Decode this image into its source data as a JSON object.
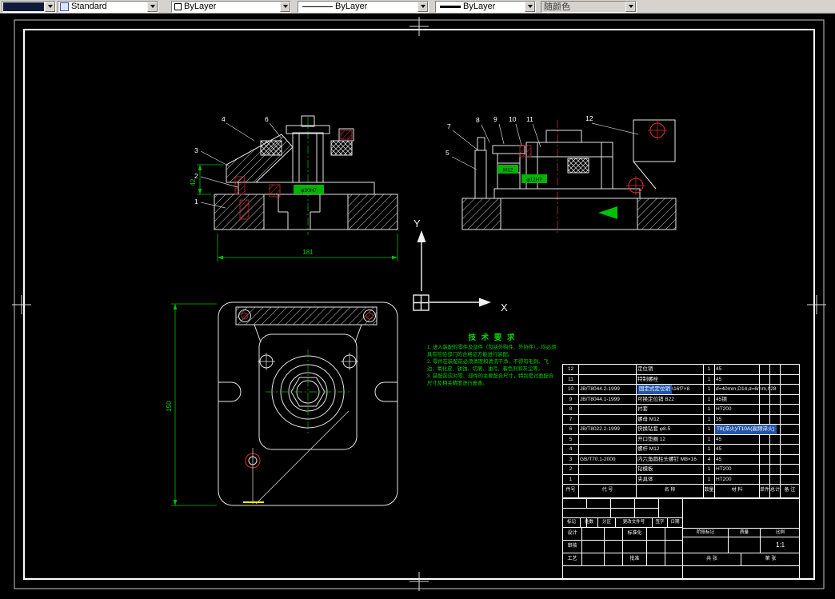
{
  "toolbar": {
    "style_combo": "Standard",
    "color_combo": "ByLayer",
    "linetype_combo": "ByLayer",
    "lineweight_combo": "ByLayer",
    "plotstyle_combo": "随颜色"
  },
  "ucs": {
    "x": "X",
    "y": "Y"
  },
  "balloons": {
    "front": [
      "4",
      "6",
      "3",
      "2",
      "1"
    ],
    "side": [
      "7",
      "8",
      "9",
      "10",
      "11",
      "12",
      "5"
    ]
  },
  "dimensions": {
    "front_width": "181",
    "front_height": "42",
    "front_bore": "φ30H7",
    "side_thread": "M12",
    "side_bore": "φ12H7",
    "plan_height": "150"
  },
  "tech_requirements": {
    "title": "技 术 要 求",
    "items": [
      "1. 进入装配的零件及部件（包括外购件、外协件），均必须具有检验部门的合格证方能进行装配。",
      "2. 零件在装配前必须清理和清洗干净，不得有毛刺、飞边、氧化皮、锈蚀、切屑、油污、着色剂和灰尘等。",
      "3. 装配前应对零、部件的主要配合尺寸，特别是过盈配合尺寸及相关精度进行复查。"
    ]
  },
  "bom": {
    "header": [
      "件号",
      "代 号",
      "名 称",
      "数量",
      "材 料",
      "单件",
      "总计",
      "备 注"
    ],
    "rows": [
      {
        "cells": [
          "12",
          "",
          "定位销",
          "1",
          "45",
          "",
          "",
          ""
        ]
      },
      {
        "cells": [
          "11",
          "",
          "特制螺栓",
          "1",
          "45",
          "",
          "",
          ""
        ]
      },
      {
        "cells": [
          "10",
          "JB/T8044.2-1999",
          "固定式定位销 A16f7×8",
          "1",
          "d=40mm,D14,d=6mm,h28",
          "",
          "",
          ""
        ]
      },
      {
        "cells": [
          "9",
          "JB/T8044.1-1999",
          "可换定位销 B22",
          "1",
          "45钢",
          "",
          "",
          ""
        ]
      },
      {
        "cells": [
          "8",
          "",
          "衬套",
          "1",
          "HT200",
          "",
          "",
          ""
        ]
      },
      {
        "cells": [
          "7",
          "",
          "螺母 M12",
          "1",
          "35",
          "",
          "",
          ""
        ]
      },
      {
        "cells": [
          "6",
          "JB/T8022.2-1999",
          "快换钻套 φ8.5",
          "1",
          "T8(淬火)/T10A(高频淬火)",
          "",
          "",
          ""
        ]
      },
      {
        "cells": [
          "5",
          "",
          "开口垫圈 12",
          "1",
          "45",
          "",
          "",
          ""
        ]
      },
      {
        "cells": [
          "4",
          "",
          "螺杆 M12",
          "1",
          "45",
          "",
          "",
          ""
        ]
      },
      {
        "cells": [
          "3",
          "GB/T70.1-2000",
          "内六角圆柱头螺钉 M8×16",
          "4",
          "45",
          "",
          "",
          ""
        ]
      },
      {
        "cells": [
          "2",
          "",
          "钻模板",
          "1",
          "HT200",
          "",
          "",
          ""
        ]
      },
      {
        "cells": [
          "1",
          "",
          "夹具体",
          "1",
          "HT200",
          "",
          "",
          ""
        ]
      }
    ],
    "highlights": [
      {
        "text": "固定式定位销"
      },
      {
        "text": "T8(淬火)/T10A(高频淬火)"
      }
    ]
  },
  "title_block": {
    "rev": [
      "标记",
      "处数",
      "分区",
      "更改文件号",
      "签字",
      "日期"
    ],
    "design": "设计",
    "standardize": "标准化",
    "audit": "审核",
    "process": "工艺",
    "approve": "批准",
    "stage": "阶段标记",
    "mass": "质量",
    "scale": "比例",
    "scale_value": "1:1",
    "total_sheets": "共 张",
    "sheet_no": "第 张"
  }
}
